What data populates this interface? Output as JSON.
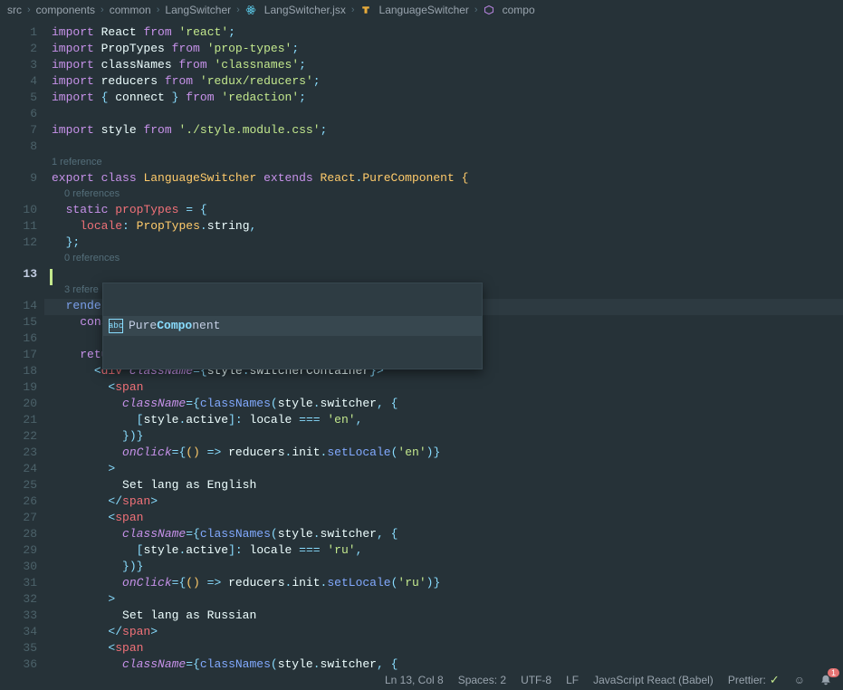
{
  "breadcrumbs": [
    "src",
    "components",
    "common",
    "LangSwitcher",
    "LangSwitcher.jsx",
    "LanguageSwitcher",
    "compo"
  ],
  "lenses": {
    "class": "1 reference",
    "propTypes": "0 references",
    "compo": "0 references",
    "render": "3 refere"
  },
  "currentLineInput": "compo",
  "suggestion": {
    "prefix": "Pure",
    "match": "Compo",
    "suffix": "nent"
  },
  "code": {
    "imports": [
      {
        "what": "React",
        "from": "react"
      },
      {
        "what": "PropTypes",
        "from": "prop-types"
      },
      {
        "what": "classNames",
        "from": "classnames"
      },
      {
        "what": "reducers",
        "from": "redux/reducers"
      },
      {
        "what": "{ connect }",
        "from": "redaction"
      },
      {
        "what": "style",
        "from": "./style.module.css"
      }
    ],
    "className": "LanguageSwitcher",
    "extends": "React.PureComponent",
    "propType": {
      "key": "locale",
      "type": "PropTypes.string"
    },
    "renderConst": "locale",
    "tags": {
      "div": "div",
      "span": "span",
      "attrClassName": "className",
      "attrOnClick": "onClick"
    },
    "styleRefs": {
      "container": "switcherContainer",
      "switcher": "switcher",
      "active": "active"
    },
    "locales": [
      "en",
      "ru"
    ],
    "setLocaleFn": "setLocale",
    "initFn": "init",
    "reducersRef": "reducers",
    "text": {
      "en": "Set lang as English",
      "ru": "Set lang as Russian"
    }
  },
  "statusbar": {
    "pos": "Ln 13, Col 8",
    "spaces": "Spaces: 2",
    "encoding": "UTF-8",
    "eol": "LF",
    "lang": "JavaScript React (Babel)",
    "prettier": "Prettier:",
    "notifications": "1"
  },
  "lineNumbers": [
    1,
    2,
    3,
    4,
    5,
    6,
    7,
    8,
    9,
    10,
    11,
    12,
    13,
    14,
    15,
    16,
    17,
    18,
    19,
    20,
    21,
    22,
    23,
    24,
    25,
    26,
    27,
    28,
    29,
    30,
    31,
    32,
    33,
    34,
    35,
    36
  ],
  "currentLine": 13
}
